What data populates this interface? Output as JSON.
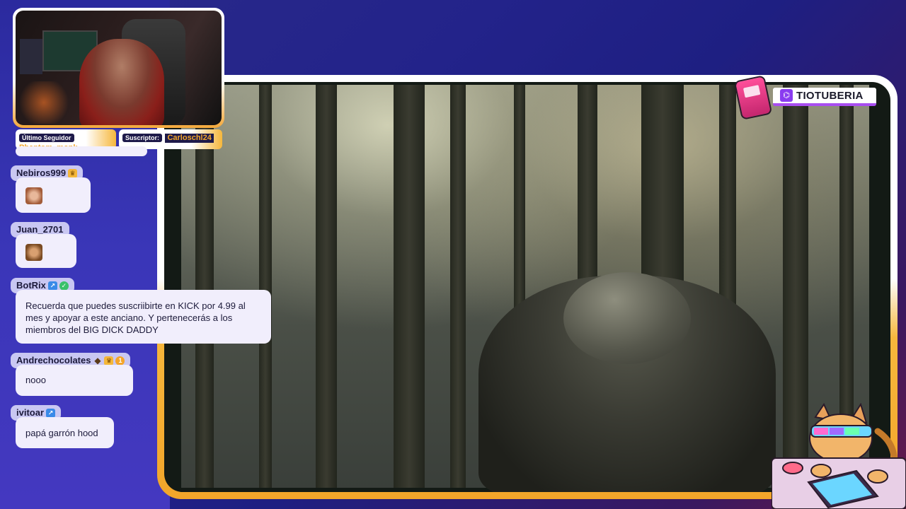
{
  "overlay": {
    "latest_follower_title": "Último Seguidor",
    "latest_follower_name": "Phantom_monk",
    "subscriber_title": "Suscriptor:",
    "subscriber_name": "Carloschl24",
    "brand": "TIOTUBERIA",
    "brand_icon": "twitch-icon"
  },
  "chat": {
    "messages": [
      {
        "user": "Nebiros999",
        "badges": [
          "crown-icon"
        ],
        "text": "",
        "emote": "face-emote"
      },
      {
        "user": "Juan_2701",
        "badges": [],
        "text": "",
        "emote": "dog-emote"
      },
      {
        "user": "BotRix",
        "badges": [
          "bot-icon",
          "verified-icon"
        ],
        "text": "Recuerda que puedes suscriibirte en KICK por 4.99 al mes y apoyar a este anciano. Y pertenecerás a los miembros del BIG DICK DADDY"
      },
      {
        "user": "Andrechocolates",
        "badges": [
          "diamond-icon",
          "crown-icon",
          "sub-1-icon"
        ],
        "text": "nooo",
        "badge_text": "1"
      },
      {
        "user": "ivitoar",
        "badges": [
          "bot-icon"
        ],
        "text": "papá garrón hood"
      }
    ]
  },
  "colors": {
    "accent_orange": "#f2a52a",
    "chat_user_bg": "#c9c7f2",
    "chat_bubble_bg": "#f1eefc",
    "twitch_purple": "#8a3cf0",
    "arcade_pink": "#ff4f9a"
  }
}
